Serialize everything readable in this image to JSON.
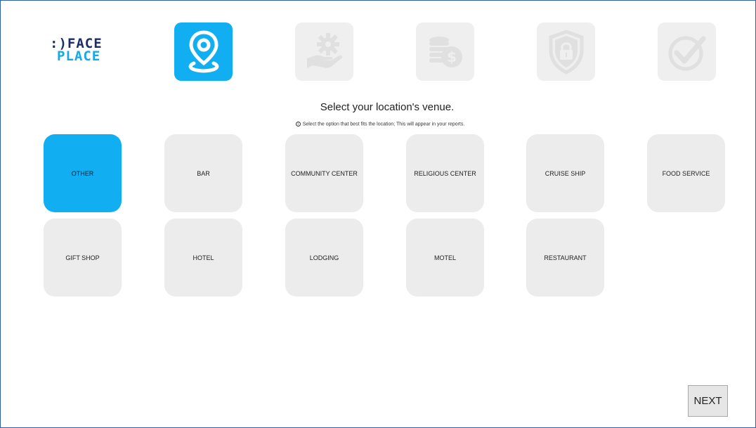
{
  "brand": {
    "logo_line1": ":)FACE",
    "logo_line2": "PLACE"
  },
  "steps": [
    {
      "icon": "location-pin-icon",
      "state": "active"
    },
    {
      "icon": "gear-hand-icon",
      "state": "inactive"
    },
    {
      "icon": "coins-icon",
      "state": "inactive"
    },
    {
      "icon": "shield-lock-icon",
      "state": "inactive"
    },
    {
      "icon": "checkmark-circle-icon",
      "state": "inactive"
    }
  ],
  "heading": {
    "title": "Select your location's venue.",
    "hint_icon": "ⓘ",
    "hint": "Select the option that best fits the location; This will appear in your reports."
  },
  "venues": {
    "selected": "OTHER",
    "options": [
      "OTHER",
      "BAR",
      "COMMUNITY CENTER",
      "RELIGIOUS CENTER",
      "CRUISE SHIP",
      "FOOD SERVICE",
      "GIFT SHOP",
      "HOTEL",
      "LODGING",
      "MOTEL",
      "RESTAURANT"
    ]
  },
  "footer": {
    "next_label": "NEXT"
  },
  "colors": {
    "accent": "#12aef2",
    "tile": "#ececec",
    "step_inactive": "#efefef",
    "border": "#2f5fb3"
  }
}
